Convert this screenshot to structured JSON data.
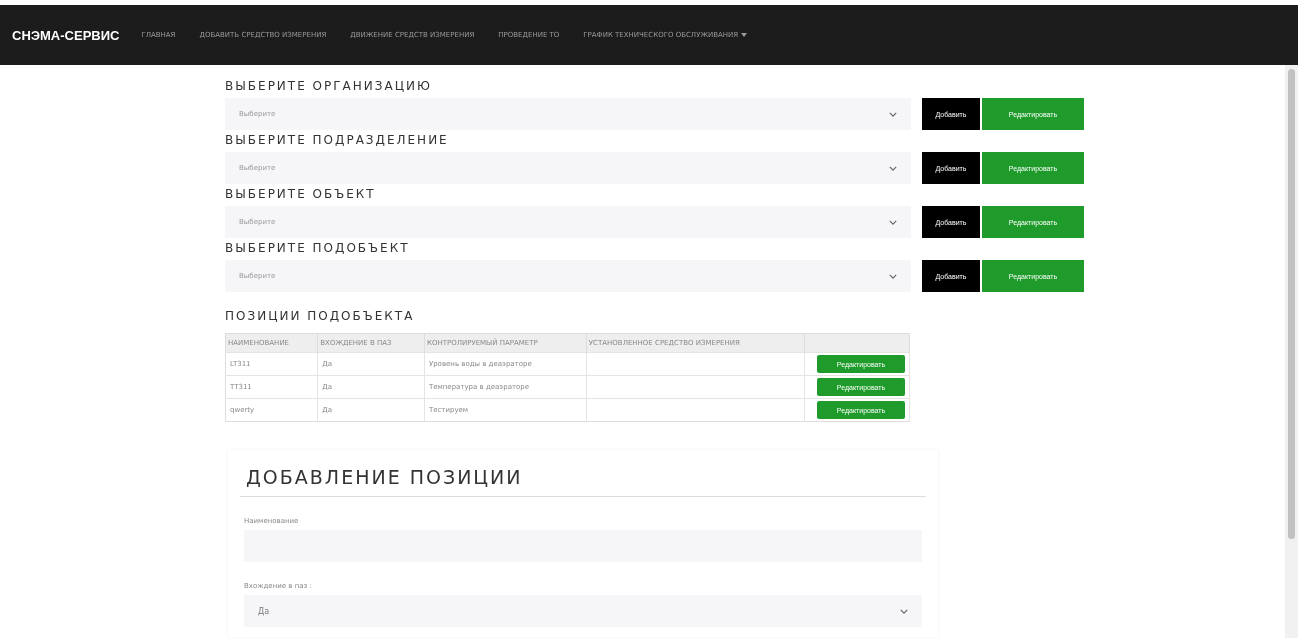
{
  "navbar": {
    "brand": "СНЭМА-СЕРВИС",
    "items": [
      {
        "label": "ГЛАВНАЯ",
        "dropdown": false
      },
      {
        "label": "ДОБАВИТЬ СРЕДСТВО ИЗМЕРЕНИЯ",
        "dropdown": false
      },
      {
        "label": "ДВИЖЕНИЕ СРЕДСТВ ИЗМЕРЕНИЯ",
        "dropdown": false
      },
      {
        "label": "ПРОВЕДЕНИЕ ТО",
        "dropdown": false
      },
      {
        "label": "ГРАФИК ТЕХНИЧЕСКОГО ОБСЛУЖИВАНИЯ",
        "dropdown": true
      }
    ]
  },
  "selectors": [
    {
      "label": "ВЫБЕРИТЕ ОРГАНИЗАЦИЮ",
      "placeholder": "Выберите",
      "add_button": "Добавить",
      "edit_button": "Редактировать"
    },
    {
      "label": "ВЫБЕРИТЕ ПОДРАЗДЕЛЕНИЕ",
      "placeholder": "Выберите",
      "add_button": "Добавить",
      "edit_button": "Редактировать"
    },
    {
      "label": "ВЫБЕРИТЕ ОБЪЕКТ",
      "placeholder": "Выберите",
      "add_button": "Добавить",
      "edit_button": "Редактировать"
    },
    {
      "label": "ВЫБЕРИТЕ ПОДОБЪЕКТ",
      "placeholder": "Выберите",
      "add_button": "Добавить",
      "edit_button": "Редактировать"
    }
  ],
  "positions": {
    "title": "ПОЗИЦИИ ПОДОБЪЕКТА",
    "columns": [
      "НАИМЕНОВАНИЕ",
      "ВХОЖДЕНИЕ В ПАЗ",
      "КОНТРОЛИРУЕМЫЙ ПАРАМЕТР",
      "УСТАНОВЛЕННОЕ СРЕДСТВО ИЗМЕРЕНИЯ"
    ],
    "rows": [
      {
        "name": "LT311",
        "in_groove": "Да",
        "parameter": "Уровень воды в деаэраторе",
        "action": "Редактировать"
      },
      {
        "name": "TT311",
        "in_groove": "Да",
        "parameter": "Температура в деаэраторе",
        "action": "Редактировать"
      },
      {
        "name": "qwerty",
        "in_groove": "Да",
        "parameter": "Тестируем",
        "action": "Редактировать"
      }
    ]
  },
  "add_form": {
    "title": "ДОБАВЛЕНИЕ ПОЗИЦИИ",
    "fields": [
      {
        "kind": "input",
        "label": "Наименование"
      },
      {
        "kind": "select",
        "label": "Вхождение в паз :",
        "value": "Да"
      }
    ]
  }
}
